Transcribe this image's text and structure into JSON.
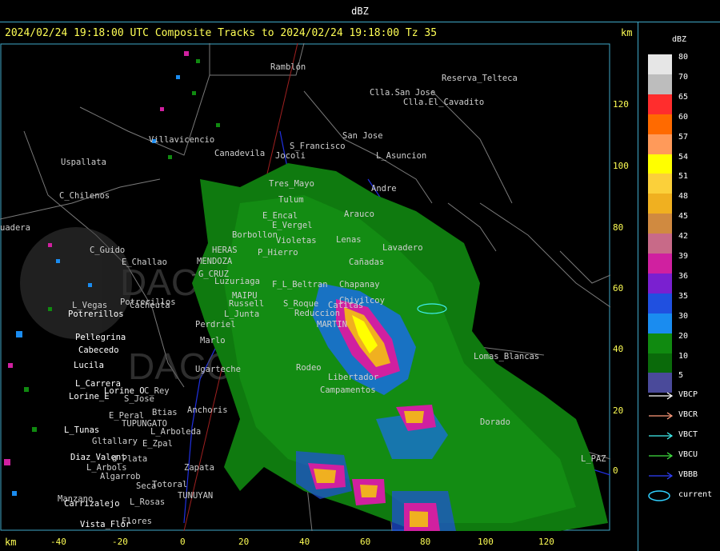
{
  "window": {
    "title": "dBZ"
  },
  "header": {
    "text": "2024/02/24 19:18:00 UTC Composite Tracks to 2024/02/24 19:18:00 Tz 35",
    "unit_right": "km",
    "unit_bottom": "km"
  },
  "axis": {
    "y_ticks": [
      "120",
      "100",
      "80",
      "60",
      "40",
      "20",
      "0"
    ],
    "x_ticks": [
      "-40",
      "-20",
      "0",
      "20",
      "40",
      "60",
      "80",
      "100",
      "120"
    ]
  },
  "places": [
    {
      "name": "Ramblón",
      "bright": false
    },
    {
      "name": "Reserva_Telteca",
      "bright": false
    },
    {
      "name": "Clla.San Jose",
      "bright": false
    },
    {
      "name": "Clla.El_Cavadito",
      "bright": false
    },
    {
      "name": "San Jose",
      "bright": false
    },
    {
      "name": "Villavicencio",
      "bright": false
    },
    {
      "name": "Canadevila",
      "bright": false
    },
    {
      "name": "S_Francisco",
      "bright": false
    },
    {
      "name": "Jocoli",
      "bright": false
    },
    {
      "name": "L_Asuncion",
      "bright": false
    },
    {
      "name": "Uspallata",
      "bright": false
    },
    {
      "name": "Tres_Mayo",
      "bright": false
    },
    {
      "name": "Tulum",
      "bright": false
    },
    {
      "name": "Andre",
      "bright": false
    },
    {
      "name": "C_Chilenos",
      "bright": false
    },
    {
      "name": "E_Encal",
      "bright": false
    },
    {
      "name": "E_Vergel",
      "bright": false
    },
    {
      "name": "Arauco",
      "bright": false
    },
    {
      "name": "uadera",
      "bright": false
    },
    {
      "name": "Borbollon",
      "bright": false
    },
    {
      "name": "Violetas",
      "bright": false
    },
    {
      "name": "Lenas",
      "bright": false
    },
    {
      "name": "Lavadero",
      "bright": false
    },
    {
      "name": "C_Guido",
      "bright": false
    },
    {
      "name": "HERAS",
      "bright": false
    },
    {
      "name": "P_Hierro",
      "bright": false
    },
    {
      "name": "E_Challao",
      "bright": false
    },
    {
      "name": "MENDOZA",
      "bright": false
    },
    {
      "name": "Cañadas",
      "bright": false
    },
    {
      "name": "G_CRUZ",
      "bright": false
    },
    {
      "name": "Luzuriaga",
      "bright": false
    },
    {
      "name": "F_L_Beltran",
      "bright": false
    },
    {
      "name": "Chapanay",
      "bright": false
    },
    {
      "name": "L_Vegas",
      "bright": false
    },
    {
      "name": "Potrerillos",
      "bright": false
    },
    {
      "name": "MAIPU",
      "bright": false
    },
    {
      "name": "Cacheuta",
      "bright": false
    },
    {
      "name": "Russell",
      "bright": false
    },
    {
      "name": "S_Roque",
      "bright": false
    },
    {
      "name": "Chivilcoy",
      "bright": false
    },
    {
      "name": "Catitas",
      "bright": false
    },
    {
      "name": "Potrerillos",
      "bright": true
    },
    {
      "name": "L_Junta",
      "bright": false
    },
    {
      "name": "Reduccion",
      "bright": false
    },
    {
      "name": "Perdriel",
      "bright": false
    },
    {
      "name": "MARTIN",
      "bright": false
    },
    {
      "name": "Pellegrina",
      "bright": true
    },
    {
      "name": "Cabecedo",
      "bright": true
    },
    {
      "name": "Marlo",
      "bright": false
    },
    {
      "name": "Lomas_Blancas",
      "bright": false
    },
    {
      "name": "Lucila",
      "bright": true
    },
    {
      "name": "Ugarteche",
      "bright": false
    },
    {
      "name": "Rodeo",
      "bright": false
    },
    {
      "name": "Libertador",
      "bright": false
    },
    {
      "name": "L_Carrera",
      "bright": true
    },
    {
      "name": "Lorine_E",
      "bright": true
    },
    {
      "name": "Lorine_O",
      "bright": true
    },
    {
      "name": "S_Jose",
      "bright": false
    },
    {
      "name": "C_Rey",
      "bright": false
    },
    {
      "name": "Campamentos",
      "bright": false
    },
    {
      "name": "Dorado",
      "bright": false
    },
    {
      "name": "E_Peral",
      "bright": false
    },
    {
      "name": "Btias",
      "bright": false
    },
    {
      "name": "Anchoris",
      "bright": false
    },
    {
      "name": "TUPUNGATO",
      "bright": false
    },
    {
      "name": "L_Tunas",
      "bright": true
    },
    {
      "name": "L_Arboleda",
      "bright": false
    },
    {
      "name": "Gltallary",
      "bright": false
    },
    {
      "name": "E_Zpal",
      "bright": false
    },
    {
      "name": "Diaz_Valent",
      "bright": true
    },
    {
      "name": "d_Plata",
      "bright": false
    },
    {
      "name": "L_Arbols",
      "bright": false
    },
    {
      "name": "Zapata",
      "bright": false
    },
    {
      "name": "L_PAZ",
      "bright": false
    },
    {
      "name": "Algarrob",
      "bright": false
    },
    {
      "name": "Seca",
      "bright": false
    },
    {
      "name": "Totoral",
      "bright": false
    },
    {
      "name": "Manzano",
      "bright": false
    },
    {
      "name": "Carrizalejo",
      "bright": true
    },
    {
      "name": "L_Rosas",
      "bright": false
    },
    {
      "name": "TUNUYAN",
      "bright": false
    },
    {
      "name": "Flores",
      "bright": false
    },
    {
      "name": "Vista_Flor",
      "bright": true
    }
  ],
  "legend": {
    "unit": "dBZ",
    "scale": [
      {
        "label": "80",
        "color": "#e6e6e6"
      },
      {
        "label": "70",
        "color": "#bdbdbd"
      },
      {
        "label": "65",
        "color": "#ff2d2d"
      },
      {
        "label": "60",
        "color": "#ff6a00"
      },
      {
        "label": "57",
        "color": "#ff9a5a"
      },
      {
        "label": "54",
        "color": "#ffff00"
      },
      {
        "label": "51",
        "color": "#fbd03a"
      },
      {
        "label": "48",
        "color": "#f0b020"
      },
      {
        "label": "45",
        "color": "#d08a40"
      },
      {
        "label": "42",
        "color": "#c86a88"
      },
      {
        "label": "39",
        "color": "#d020a0"
      },
      {
        "label": "36",
        "color": "#7a20d0"
      },
      {
        "label": "35",
        "color": "#2050e0"
      },
      {
        "label": "30",
        "color": "#1a8cf0"
      },
      {
        "label": "20",
        "color": "#108a10"
      },
      {
        "label": "10",
        "color": "#0a6a0a"
      },
      {
        "label": "5",
        "color": "#4a4a9a"
      }
    ],
    "tracks": [
      {
        "label": "VBCP",
        "color": "#ffffff"
      },
      {
        "label": "VBCR",
        "color": "#ff9a7a"
      },
      {
        "label": "VBCT",
        "color": "#40f0f0"
      },
      {
        "label": "VBCU",
        "color": "#40e040"
      },
      {
        "label": "VBBB",
        "color": "#3040ff"
      },
      {
        "label": "current",
        "color": "#30d0ff"
      }
    ]
  },
  "watermark": "DACC"
}
